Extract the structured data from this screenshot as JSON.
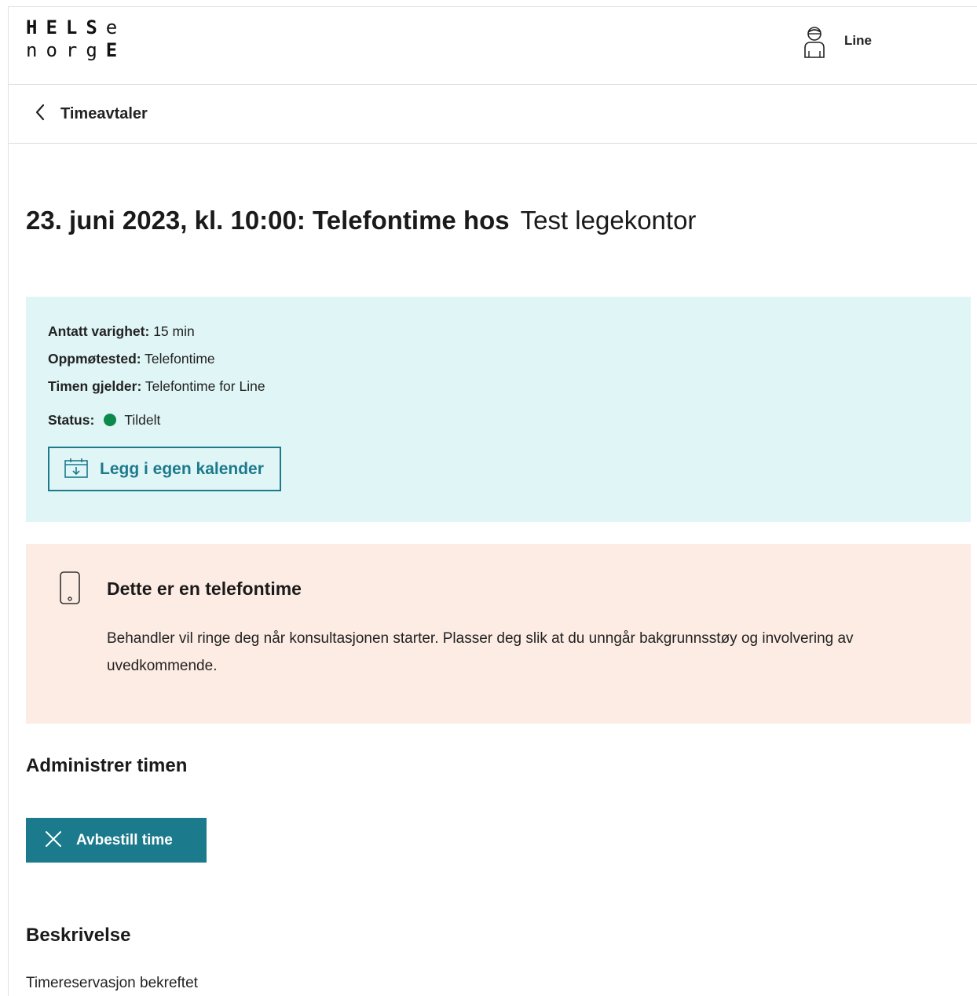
{
  "header": {
    "logo": {
      "line1_bold": "HELS",
      "line1_regular": "e",
      "line2_regular": "norg",
      "line2_bold": "E"
    },
    "user_name": "Line",
    "user_icon": "user-icon"
  },
  "breadcrumb": {
    "back_icon": "chevron-left-icon",
    "back_label": "Timeavtaler"
  },
  "appointment": {
    "title_bold": "23. juni 2023, kl. 10:00: Telefontime hos",
    "title_regular": "Test legekontor"
  },
  "details": {
    "duration_label": "Antatt varighet:",
    "duration_value": "15 min",
    "location_label": "Oppmøtested:",
    "location_value": "Telefontime",
    "subject_label": "Timen gjelder:",
    "subject_value": "Telefontime for Line",
    "status_label": "Status:",
    "status_value": "Tildelt",
    "status_color": "#0b8a4c",
    "calendar_button_label": "Legg i egen kalender",
    "calendar_icon": "calendar-download-icon"
  },
  "notice": {
    "icon": "mobile-phone-icon",
    "title": "Dette er en telefontime",
    "body": "Behandler vil ringe deg når konsultasjonen starter. Plasser deg slik at du unngår bakgrunnsstøy og involvering av uvedkommende."
  },
  "admin": {
    "heading": "Administrer timen",
    "cancel_button_label": "Avbestill time",
    "cancel_icon": "close-icon"
  },
  "description": {
    "heading": "Beskrivelse",
    "text": "Timereservasjon bekreftet"
  },
  "colors": {
    "accent": "#1b7a8c",
    "info_background": "#e0f5f6",
    "notice_background": "#fdece4"
  }
}
